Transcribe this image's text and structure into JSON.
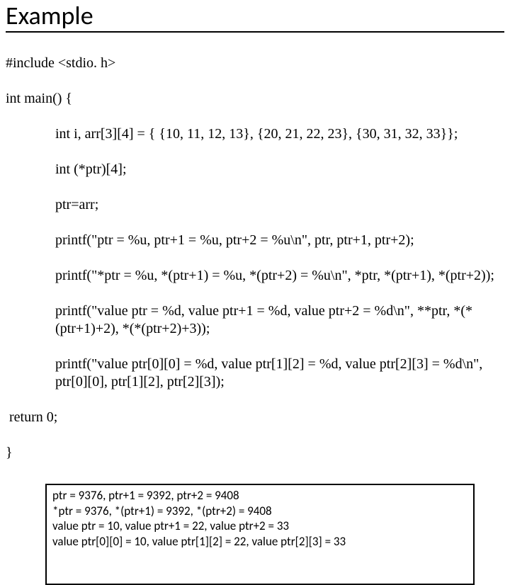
{
  "title": "Example",
  "code": {
    "l1": "#include <stdio. h>",
    "l2": "int main() {",
    "l3": "int i, arr[3][4] = { {10, 11, 12, 13}, {20, 21, 22, 23}, {30, 31, 32, 33}};",
    "l4": "int (*ptr)[4];",
    "l5": "ptr=arr;",
    "l6": "printf(\"ptr = %u, ptr+1 = %u, ptr+2 = %u\\n\", ptr, ptr+1, ptr+2);",
    "l7": "printf(\"*ptr = %u, *(ptr+1) = %u, *(ptr+2) = %u\\n\", *ptr, *(ptr+1), *(ptr+2));",
    "l8": "printf(\"value ptr = %d, value ptr+1 = %d, value ptr+2 = %d\\n\", **ptr, *(*(ptr+1)+2), *(*(ptr+2)+3));",
    "l9": "printf(\"value ptr[0][0] = %d, value ptr[1][2] = %d, value ptr[2][3] = %d\\n\", ptr[0][0], ptr[1][2], ptr[2][3]);",
    "l10": " return 0;",
    "l11": "}"
  },
  "output": {
    "o1": "ptr = 9376, ptr+1 = 9392, ptr+2 = 9408",
    "o2": "*ptr = 9376, *(ptr+1) = 9392, *(ptr+2) = 9408",
    "o3": "value ptr = 10, value ptr+1 = 22, value ptr+2 = 33",
    "o4": "value ptr[0][0] = 10, value ptr[1][2] = 22, value ptr[2][3] = 33"
  }
}
